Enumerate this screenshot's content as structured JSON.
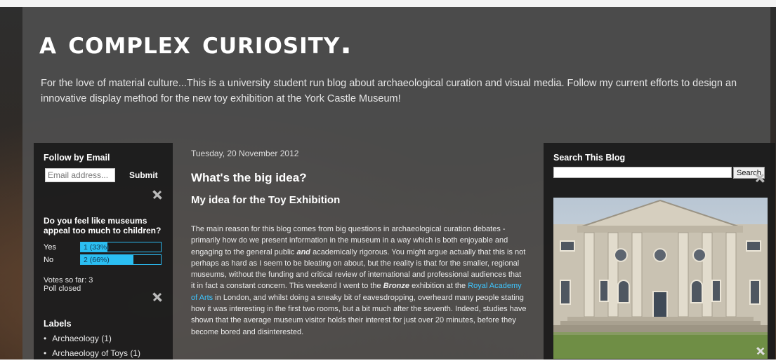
{
  "header": {
    "title": "A Complex Curiosity.",
    "description": "For the love of material culture...This is a university student run blog about archaeological curation and visual media. Follow my current efforts to design an innovative display method for the new toy exhibition at the York Castle Museum!"
  },
  "follow_by_email": {
    "title": "Follow by Email",
    "placeholder": "Email address...",
    "submit_label": "Submit"
  },
  "poll": {
    "question": "Do you feel like museums appeal too much to children?",
    "options": [
      {
        "label": "Yes",
        "result": "1 (33%)",
        "percent": 33
      },
      {
        "label": "No",
        "result": "2 (66%)",
        "percent": 66
      }
    ],
    "votes": "Votes so far: 3",
    "status": "Poll closed"
  },
  "labels": {
    "title": "Labels",
    "items": [
      "Archaeology (1)",
      "Archaeology of Toys (1)"
    ]
  },
  "post": {
    "date": "Tuesday, 20 November 2012",
    "title": "What's the big idea?",
    "subtitle": "My idea for the Toy Exhibition",
    "body_1": "The main reason for this blog comes from big questions in archaeological curation debates - primarily how do we present information in the museum in a way which is both enjoyable and engaging to the general public ",
    "body_and": "and",
    "body_2": " academically rigorous. You might argue actually that this is not perhaps as hard as I seem to be bleating on about, but the reality is that for the smaller, regional museums, without the funding and critical review of international and professional audiences that it in fact a constant concern. This weekend I went to the ",
    "body_bronze": "Bronze",
    "body_3": " exhibition at the ",
    "body_link": "Royal Academy of Arts",
    "body_4": " in London, and whilst doing a sneaky bit of eavesdropping, overheard many people stating how it was interesting in the first two rooms, but a bit much after the seventh. Indeed, studies have shown that the average museum visitor holds their interest for just over 20 minutes, before they become bored and disinterested."
  },
  "search": {
    "title": "Search This Blog",
    "button_label": "Search"
  },
  "icons": {
    "edit": "wrench-screwdriver-icon"
  },
  "colors": {
    "poll_bar": "#2bbff2",
    "link": "#3ec6ff"
  }
}
